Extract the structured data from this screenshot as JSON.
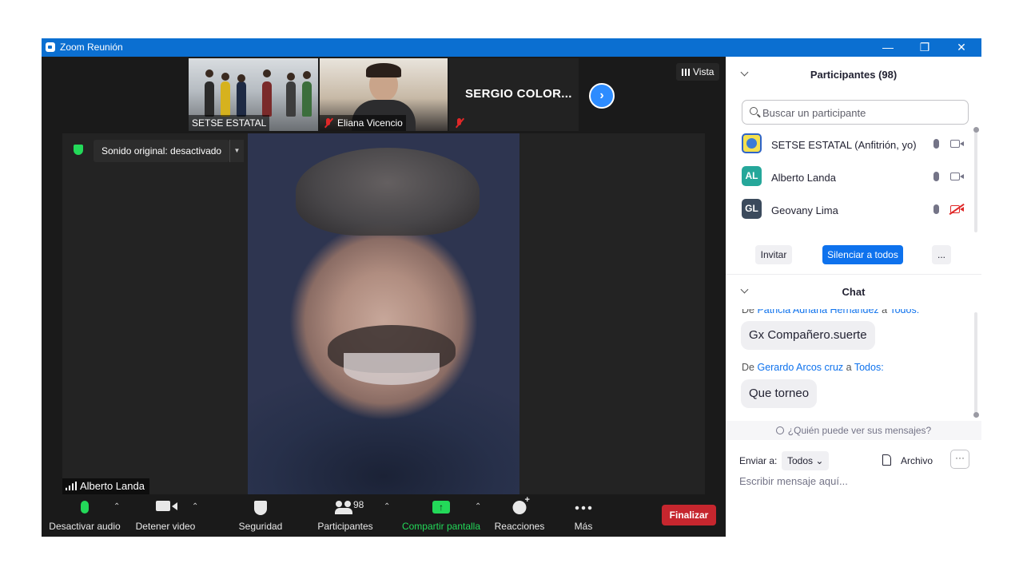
{
  "window": {
    "title": "Zoom Reunión",
    "min": "—",
    "max": "❐",
    "close": "✕"
  },
  "thumbnails": [
    {
      "name": "SETSE ESTATAL"
    },
    {
      "name": "Eliana Vicencio"
    },
    {
      "name": "SERGIO  COLOR..."
    }
  ],
  "view": {
    "label": "Vista"
  },
  "main": {
    "sound": "Sonido original: desactivado",
    "speaker": "Alberto Landa"
  },
  "toolbar": {
    "audio": "Desactivar audio",
    "video": "Detener video",
    "security": "Seguridad",
    "participants": "Participantes",
    "participants_count": "98",
    "share": "Compartir pantalla",
    "reactions": "Reacciones",
    "more": "Más",
    "end": "Finalizar"
  },
  "participants_panel": {
    "title": "Participantes (98)",
    "search_placeholder": "Buscar un participante",
    "rows": [
      {
        "initials": "",
        "name": "SETSE ESTATAL (Anfitrión, yo)",
        "avatar_color": "#f4e04d",
        "camera": "on"
      },
      {
        "initials": "AL",
        "name": "Alberto Landa",
        "avatar_color": "#25a79a",
        "camera": "on"
      },
      {
        "initials": "GL",
        "name": "Geovany Lima",
        "avatar_color": "#3b4a5c",
        "camera": "off"
      }
    ],
    "invite": "Invitar",
    "mute_all": "Silenciar a todos",
    "more": "..."
  },
  "chat": {
    "title": "Chat",
    "messages": [
      {
        "prefix": "De",
        "from": "Patricia Adriana Hernández",
        "mid": "a",
        "to": "Todos:",
        "text": "Gx Compañero.suerte"
      },
      {
        "prefix": "De",
        "from": "Gerardo Arcos cruz",
        "mid": "a",
        "to": "Todos:",
        "text": "Que torneo"
      }
    ],
    "who_can_see": "¿Quién puede ver sus mensajes?",
    "send_to_label": "Enviar a:",
    "send_to_value": "Todos",
    "file": "Archivo",
    "more": "···",
    "input_placeholder": "Escribir mensaje aquí..."
  },
  "colors": {
    "titlebar": "#0b6fd1",
    "accent": "#0e72ed",
    "end": "#c6262e",
    "green": "#23d959"
  }
}
